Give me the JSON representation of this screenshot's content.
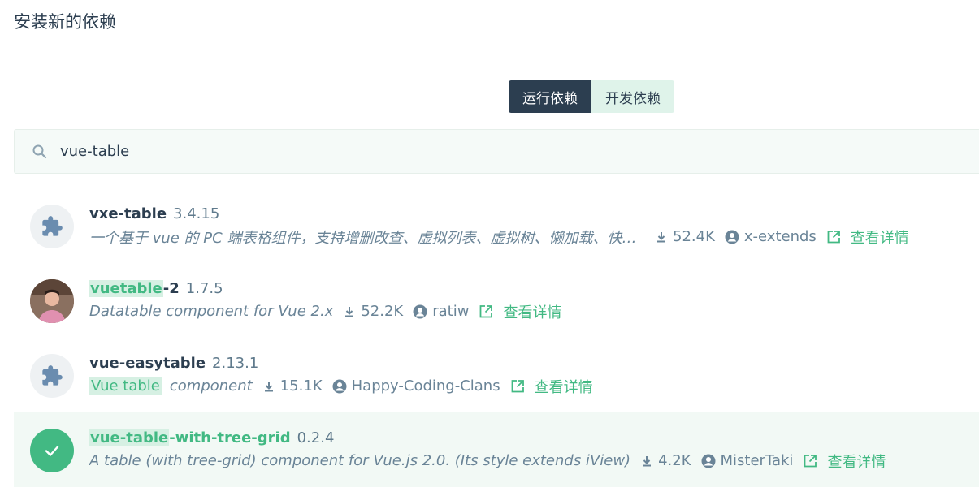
{
  "page": {
    "title": "安装新的依赖"
  },
  "tabs": [
    {
      "label": "运行依赖",
      "active": true
    },
    {
      "label": "开发依赖",
      "active": false
    }
  ],
  "search": {
    "value": "vue-table",
    "placeholder": ""
  },
  "results": [
    {
      "name": "vxe-table",
      "version": "3.4.15",
      "description": "一个基于 vue 的 PC 端表格组件，支持增删改查、虚拟列表、虚拟树、懒加载、快捷菜单、数据校验、打印导出、表单渲染、数据分页、弹窗、自定义模板、渲染器、贼灵活的配置项、扩展接口等...",
      "downloads": "52.4K",
      "author": "x-extends",
      "details_label": "查看详情",
      "icon": "puzzle-icon"
    },
    {
      "name_highlight": "vuetable",
      "name_rest": "-2",
      "version": "1.7.5",
      "description": "Datatable component for Vue 2.x",
      "downloads": "52.2K",
      "author": "ratiw",
      "details_label": "查看详情",
      "icon": "user-photo"
    },
    {
      "name": "vue-easytable",
      "version": "2.13.1",
      "description_highlight": "Vue table",
      "description_rest": "component",
      "downloads": "15.1K",
      "author": "Happy-Coding-Clans",
      "details_label": "查看详情",
      "icon": "puzzle-icon"
    },
    {
      "name_highlight": "vue-table",
      "name_rest": "-with-tree-grid",
      "version": "0.2.4",
      "description": "A table (with tree-grid) component for Vue.js 2.0. (Its style extends iView)",
      "downloads": "4.2K",
      "author": "MisterTaki",
      "details_label": "查看详情",
      "icon": "check-icon",
      "selected": true
    }
  ],
  "colors": {
    "accent": "#42b983",
    "dark": "#2c3e50",
    "highlight_bg": "#d6f0e3"
  }
}
